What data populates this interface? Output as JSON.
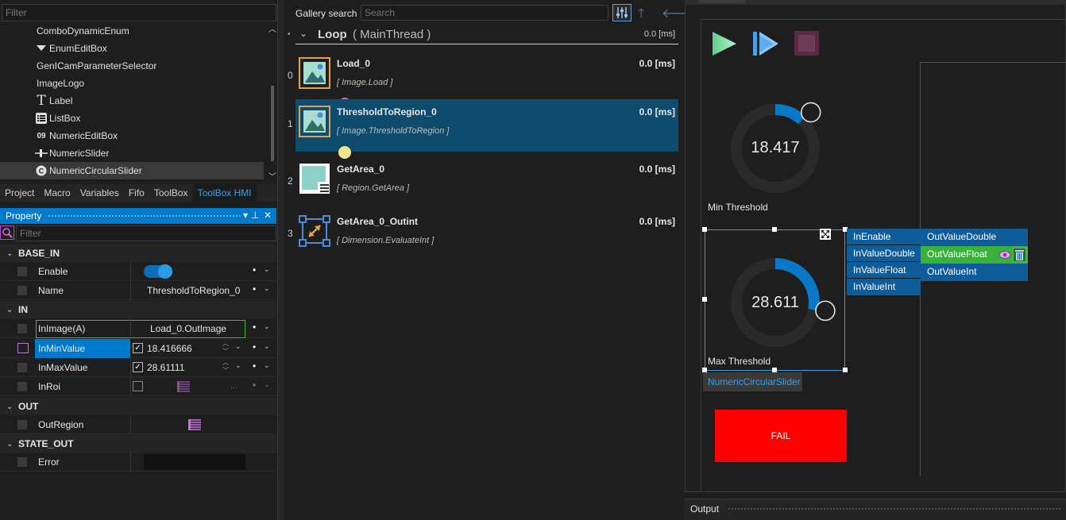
{
  "toolbox": {
    "filter_placeholder": "Filter",
    "items": [
      {
        "label": "ComboDynamicEnum",
        "icon": ""
      },
      {
        "label": "EnumEditBox",
        "icon": "dropdown-triangle-icon"
      },
      {
        "label": "GenICamParameterSelector",
        "icon": ""
      },
      {
        "label": "ImageLogo",
        "icon": ""
      },
      {
        "label": "Label",
        "icon": "text-t-icon"
      },
      {
        "label": "ListBox",
        "icon": "list-icon"
      },
      {
        "label": "NumericEditBox",
        "icon": "numeric-09-icon"
      },
      {
        "label": "NumericSlider",
        "icon": "slider-icon"
      },
      {
        "label": "NumericCircularSlider",
        "icon": "circular-slider-icon"
      }
    ],
    "tabs": [
      "Project",
      "Macro",
      "Variables",
      "Fifo",
      "ToolBox",
      "ToolBox HMI"
    ],
    "active_tab": "ToolBox HMI"
  },
  "property_panel": {
    "title": "Property",
    "filter_placeholder": "Filter",
    "sections": {
      "base_in": "BASE_IN",
      "in": "IN",
      "out": "OUT",
      "state_out": "STATE_OUT"
    },
    "rows": {
      "enable": {
        "name": "Enable",
        "value": "on"
      },
      "name": {
        "name": "Name",
        "value": "ThresholdToRegion_0"
      },
      "inimage": {
        "name": "InImage(A)",
        "value": "Load_0.OutImage"
      },
      "inmin": {
        "name": "InMinValue",
        "value": "18.416666"
      },
      "inmax": {
        "name": "InMaxValue",
        "value": "28.61111"
      },
      "inroi": {
        "name": "InRoi",
        "value": "..."
      },
      "outregion": {
        "name": "OutRegion"
      },
      "error": {
        "name": "Error"
      }
    },
    "dot": "•",
    "dropdown": "⌄"
  },
  "gallery": {
    "label": "Gallery search :",
    "placeholder": "Search"
  },
  "loop": {
    "name": "Loop",
    "thread": "( MainThread )",
    "time": "0.0 [ms]"
  },
  "steps": [
    {
      "index": "0",
      "title": "Load_0",
      "sub": "[ Image.Load ]",
      "time": "0.0 [ms]"
    },
    {
      "index": "1",
      "title": "ThresholdToRegion_0",
      "sub": "[ Image.ThresholdToRegion ]",
      "time": "0.0 [ms]"
    },
    {
      "index": "2",
      "title": "GetArea_0",
      "sub": "[ Region.GetArea ]",
      "time": "0.0 [ms]"
    },
    {
      "index": "3",
      "title": "GetArea_0_Outint",
      "sub": "[ Dimension.EvaluateInt ]",
      "time": "0.0 [ms]"
    }
  ],
  "hmi": {
    "dial_min": {
      "value": "18.417",
      "label": "Min Threshold",
      "level": 0.12
    },
    "dial_max": {
      "value": "28.611",
      "label": "Max Threshold",
      "level": 0.28
    },
    "widget_tag": "NumericCircularSlider",
    "fail_label": "FAIL",
    "in_pins": [
      "InEnable",
      "InValueDouble",
      "InValueFloat",
      "InValueInt"
    ],
    "out_pins": [
      "OutValueDouble",
      "OutValueFloat",
      "OutValueInt"
    ],
    "accent": "#007acc",
    "fail_color": "#ff0000"
  },
  "output": {
    "title": "Output"
  }
}
